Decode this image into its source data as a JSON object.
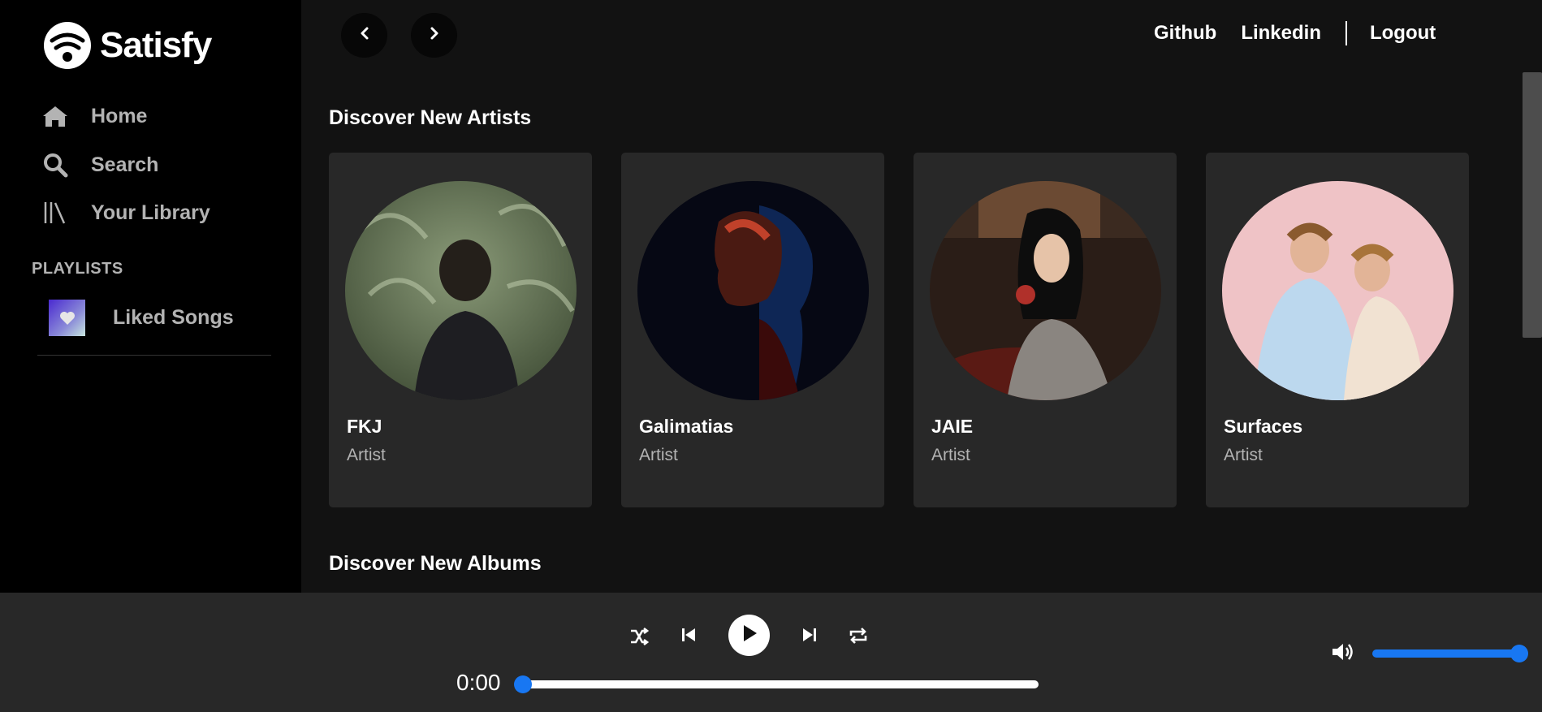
{
  "app": {
    "name": "Satisfy"
  },
  "sidebar": {
    "nav": [
      {
        "label": "Home",
        "icon": "home-icon"
      },
      {
        "label": "Search",
        "icon": "search-icon"
      },
      {
        "label": "Your Library",
        "icon": "library-icon"
      }
    ],
    "playlists_heading": "PLAYLISTS",
    "playlists": [
      {
        "label": "Liked Songs",
        "icon": "heart-icon"
      }
    ]
  },
  "topbar": {
    "back_icon": "chevron-left-icon",
    "forward_icon": "chevron-right-icon",
    "links": {
      "github": "Github",
      "linkedin": "Linkedin",
      "logout": "Logout"
    }
  },
  "main": {
    "sections": [
      {
        "title": "Discover New Artists",
        "items": [
          {
            "name": "FKJ",
            "type": "Artist"
          },
          {
            "name": "Galimatias",
            "type": "Artist"
          },
          {
            "name": "JAIE",
            "type": "Artist"
          },
          {
            "name": "Surfaces",
            "type": "Artist"
          }
        ]
      },
      {
        "title": "Discover New Albums",
        "items": []
      }
    ]
  },
  "player": {
    "current_time": "0:00",
    "progress_fraction": 0,
    "volume_fraction": 1,
    "controls": [
      "shuffle-icon",
      "previous-icon",
      "play-icon",
      "next-icon",
      "repeat-icon"
    ],
    "accent_color": "#1877f2"
  },
  "colors": {
    "sidebar_bg": "#000000",
    "main_bg": "#121212",
    "card_bg": "#282828",
    "muted_text": "#b3b3b3"
  }
}
